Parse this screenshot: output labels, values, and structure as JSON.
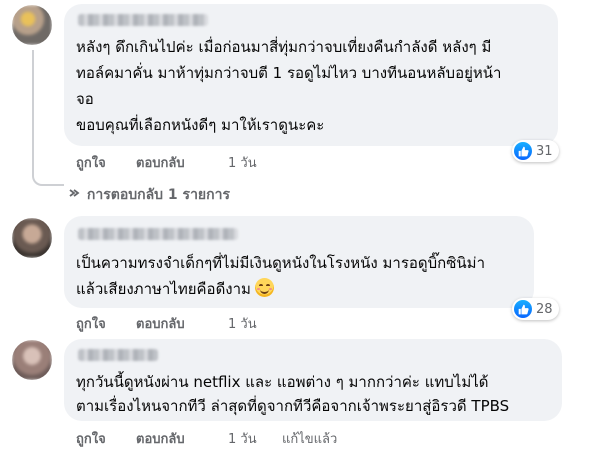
{
  "comments": [
    {
      "lines": [
        "หลังๆ ดึกเกินไปค่ะ เมื่อก่อนมาสี่ทุ่มกว่าจบเที่ยงคืนกำลังดี หลังๆ มี",
        "ทอล์คมาคั่น มาห้าทุ่มกว่าจบตี 1 รอดูไม่ไหว บางทีนอนหลับอยู่หน้า",
        "จอ",
        "ขอบคุณที่เลือกหนังดีๆ มาให้เราดูนะคะ"
      ],
      "like_label": "ถูกใจ",
      "reply_label": "ตอบกลับ",
      "time": "1 วัน",
      "reaction_count": "31",
      "replies_text": "การตอบกลับ 1 รายการ"
    },
    {
      "lines": [
        "เป็นความทรงจำเด็กๆที่ไม่มีเงินดูหนังในโรงหนัง มารอดูบิ๊กซินิม่า",
        "แล้วเสียงภาษาไทยคือดีงาม"
      ],
      "like_label": "ถูกใจ",
      "reply_label": "ตอบกลับ",
      "time": "1 วัน",
      "reaction_count": "28"
    },
    {
      "lines": [
        "ทุกวันนี้ดูหนังผ่าน netflix และ แอพต่าง ๆ มากกว่าค่ะ แทบไม่ได้",
        "ตามเรื่องไหนจากทีวี ล่าสุดที่ดูจากทีวีคือจากเจ้าพระยาสู่อิรวดี TPBS"
      ],
      "like_label": "ถูกใจ",
      "reply_label": "ตอบกลับ",
      "time": "1 วัน",
      "edited_label": "แก้ไขแล้ว"
    }
  ],
  "colors": {
    "bubble": "#f0f2f5",
    "meta_text": "#65676b",
    "like_blue": "#0866ff"
  },
  "icons": {
    "reaction": "like-thumb-icon",
    "reply_arrow": "reply-arrow-icon",
    "emoji": "smiling-face-emoji"
  }
}
